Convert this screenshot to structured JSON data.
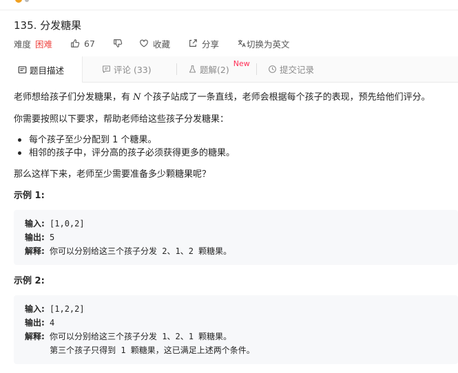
{
  "problem": {
    "title": "135. 分发糖果",
    "difficulty_label": "难度",
    "difficulty_value": "困难",
    "likes": "67",
    "favorite_label": "收藏",
    "share_label": "分享",
    "switch_lang_label": "切换为英文"
  },
  "tabs": [
    {
      "label": "题目描述"
    },
    {
      "label": "评论 (33)"
    },
    {
      "label": "题解(2)",
      "badge": "New"
    },
    {
      "label": "提交记录"
    }
  ],
  "description": {
    "p1_before": "老师想给孩子们分发糖果，有 ",
    "p1_var": "N",
    "p1_after": " 个孩子站成了一条直线，老师会根据每个孩子的表现，预先给他们评分。",
    "p2": "你需要按照以下要求，帮助老师给这些孩子分发糖果：",
    "rules": [
      "每个孩子至少分配到 1 个糖果。",
      "相邻的孩子中，评分高的孩子必须获得更多的糖果。"
    ],
    "p3": "那么这样下来，老师至少需要准备多少颗糖果呢？"
  },
  "examples": [
    {
      "heading": "示例 1:",
      "input_label": "输入:",
      "input_value": " [1,0,2]",
      "output_label": "输出:",
      "output_value": " 5",
      "explain_label": "解释:",
      "explain_value": " 你可以分别给这三个孩子分发 2、1、2 颗糖果。",
      "explain_extra": ""
    },
    {
      "heading": "示例 2:",
      "input_label": "输入:",
      "input_value": " [1,2,2]",
      "output_label": "输出:",
      "output_value": " 4",
      "explain_label": "解释:",
      "explain_value": " 你可以分别给这三个孩子分发 1、2、1 颗糖果。",
      "explain_extra": "     第三个孩子只得到 1 颗糖果，这已满足上述两个条件。"
    }
  ]
}
